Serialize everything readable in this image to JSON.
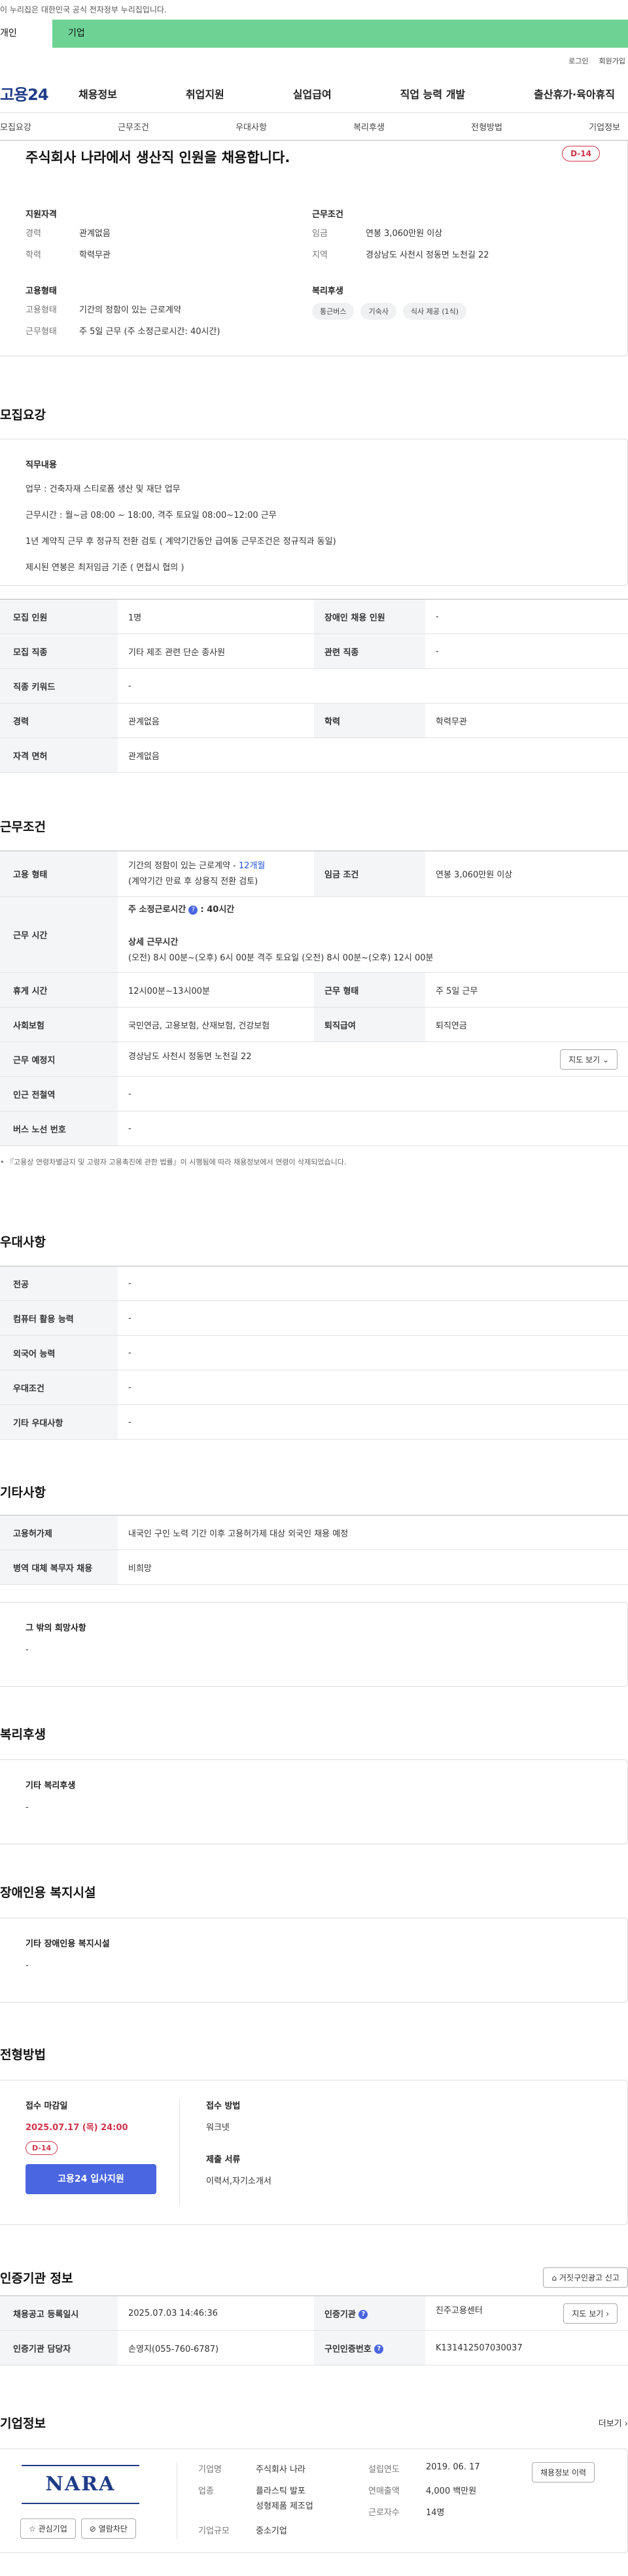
{
  "gov_notice": "이 누리집은 대한민국 공식 전자정부 누리집입니다.",
  "user_tabs": [
    "개인",
    "기업"
  ],
  "util_links": [
    "로그인",
    "회원가입"
  ],
  "logo": "고용24",
  "gnb": [
    "채용정보",
    "취업지원",
    "실업급여",
    "직업 능력 개발",
    "출산휴가·육아휴직"
  ],
  "subtabs": [
    "모집요강",
    "근무조건",
    "우대사항",
    "복리후생",
    "전형방법",
    "기업정보"
  ],
  "summary": {
    "title": "주식회사 나라에서 생산직 인원을 채용합니다.",
    "dday": "D-14",
    "qual_h": "지원자격",
    "career_k": "경력",
    "career_v": "관계없음",
    "edu_k": "학력",
    "edu_v": "학력무관",
    "emp_h": "고용형태",
    "emp_k": "고용형태",
    "emp_v": "기간의 정함이 있는 근로계약",
    "work_k": "근무형태",
    "work_v": "주 5일 근무 (주 소정근로시간: 40시간)",
    "cond_h": "근무조건",
    "wage_k": "임금",
    "wage_v": "연봉 3,060만원 이상",
    "region_k": "지역",
    "region_v": "경상남도 사천시 정동면 노천길 22",
    "welfare_h": "복리후생",
    "chips": [
      "통근버스",
      "기숙사",
      "식사 제공 (1식)"
    ]
  },
  "recruit": {
    "title": "모집요강",
    "duty_h": "직무내용",
    "duty_lines": [
      "업무 : 건축자재 스티로폼 생산 및 재단 업무",
      "근무시간 : 월~금  08:00 ~ 18:00, 격주 토요일 08:00~12:00  근무",
      "1년 계약직 근무 후 정규직 전환 검토 ( 계약기간동안 급여동 근무조건은 정규직과 동일)",
      "제시된 연봉은 최저임금 기준 ( 면접시 협의 )"
    ],
    "rows": {
      "r1k": "모집 인원",
      "r1v": "1명",
      "r1k2": "장애인 채용 인원",
      "r1v2": "-",
      "r2k": "모집 직종",
      "r2v": "기타 제조 관련 단순 종사원",
      "r2k2": "관련 직종",
      "r2v2": "-",
      "r3k": "직종 키워드",
      "r3v": "-",
      "r4k": "경력",
      "r4v": "관계없음",
      "r4k2": "학력",
      "r4v2": "학력무관",
      "r5k": "자격 면허",
      "r5v": "관계없음"
    }
  },
  "conditions": {
    "title": "근무조건",
    "emp_k": "고용 형태",
    "emp_v1": "기간의 정함이 있는 근로계약 - ",
    "emp_v1b": "12개월",
    "emp_v2": "(계약기간 만료 후 상용직 전환 검토)",
    "wage_k": "임금 조건",
    "wage_v": "연봉 3,060만원 이상",
    "hours_k": "근무 시간",
    "hours_a": "주 소정근로시간",
    "hours_a2": ": 40시간",
    "hours_b": "상세 근무시간",
    "hours_c": "(오전) 8시 00분~(오후) 6시 00분 격주 토요일 (오전) 8시 00분~(오후) 12시 00분",
    "rest_k": "휴게 시간",
    "rest_v": "12시00분~13시00분",
    "wtype_k": "근무 형태",
    "wtype_v": "주 5일 근무",
    "ins_k": "사회보험",
    "ins_v": "국민연금, 고용보험, 산재보험, 건강보험",
    "ret_k": "퇴직급여",
    "ret_v": "퇴직연금",
    "loc_k": "근무 예정지",
    "loc_v": "경상남도 사천시 정동면 노천길 22",
    "map_btn": "지도 보기",
    "sub_k": "인근 전철역",
    "sub_v": "-",
    "bus_k": "버스 노선 번호",
    "bus_v": "-",
    "note": "『고용상 연령차별금지 및 고령자 고용촉진에 관한 법률』이 시행됨에 따라 채용정보에서 연령이 삭제되었습니다."
  },
  "pref": {
    "title": "우대사항",
    "rows": [
      [
        "전공",
        "-"
      ],
      [
        "컴퓨터 활용 능력",
        "-"
      ],
      [
        "외국어 능력",
        "-"
      ],
      [
        "우대조건",
        "-"
      ],
      [
        "기타 우대사항",
        "-"
      ]
    ]
  },
  "etc": {
    "title": "기타사항",
    "r1k": "고용허가제",
    "r1v": "내국인 구인 노력 기간 이후 고용허가제 대상 외국인 채용 예정",
    "r2k": "병역 대체 복무자 채용",
    "r2v": "비희망",
    "box_h": "그 밖의 희망사항",
    "box_v": "-"
  },
  "welfare": {
    "title": "복리후생",
    "box_h": "기타 복리후생",
    "box_v": "-"
  },
  "disab": {
    "title": "장애인용 복지시설",
    "box_h": "기타 장애인용 복지시설",
    "box_v": "-"
  },
  "selection": {
    "title": "전형방법",
    "deadline_h": "접수 마감일",
    "deadline_v": "2025.07.17 (목) 24:00",
    "dday": "D-14",
    "apply_btn": "고용24 입사지원",
    "method_h": "접수 방법",
    "method_v": "워크넷",
    "docs_h": "제출 서류",
    "docs_v": "이력서,자기소개서"
  },
  "agency": {
    "title": "인증기관 정보",
    "report_btn": "거짓구인광고 신고",
    "reg_k": "채용공고 등록일시",
    "reg_v": "2025.07.03 14:46:36",
    "org_k": "인증기관",
    "org_v": "진주고용센터",
    "map_btn": "지도 보기",
    "mgr_k": "인증기관 담당자",
    "mgr_v": "손영지(055-760-6787)",
    "no_k": "구인인증번호",
    "no_v": "K131412507030037"
  },
  "company": {
    "title": "기업정보",
    "more": "더보기",
    "logo": "NARA",
    "fav_btn": "관심기업",
    "block_btn": "열람차단",
    "name_k": "기업명",
    "name_v": "주식회사 나라",
    "ind_k": "업종",
    "ind_v1": "플라스틱 발포",
    "ind_v2": "성형제품 제조업",
    "size_k": "기업규모",
    "size_v": "중소기업",
    "est_k": "설립연도",
    "est_v": "2019. 06. 17",
    "sales_k": "연매출액",
    "sales_v": "4,000 백만원",
    "emp_k": "근로자수",
    "emp_v": "14명",
    "hist_btn": "채용정보 이력"
  }
}
